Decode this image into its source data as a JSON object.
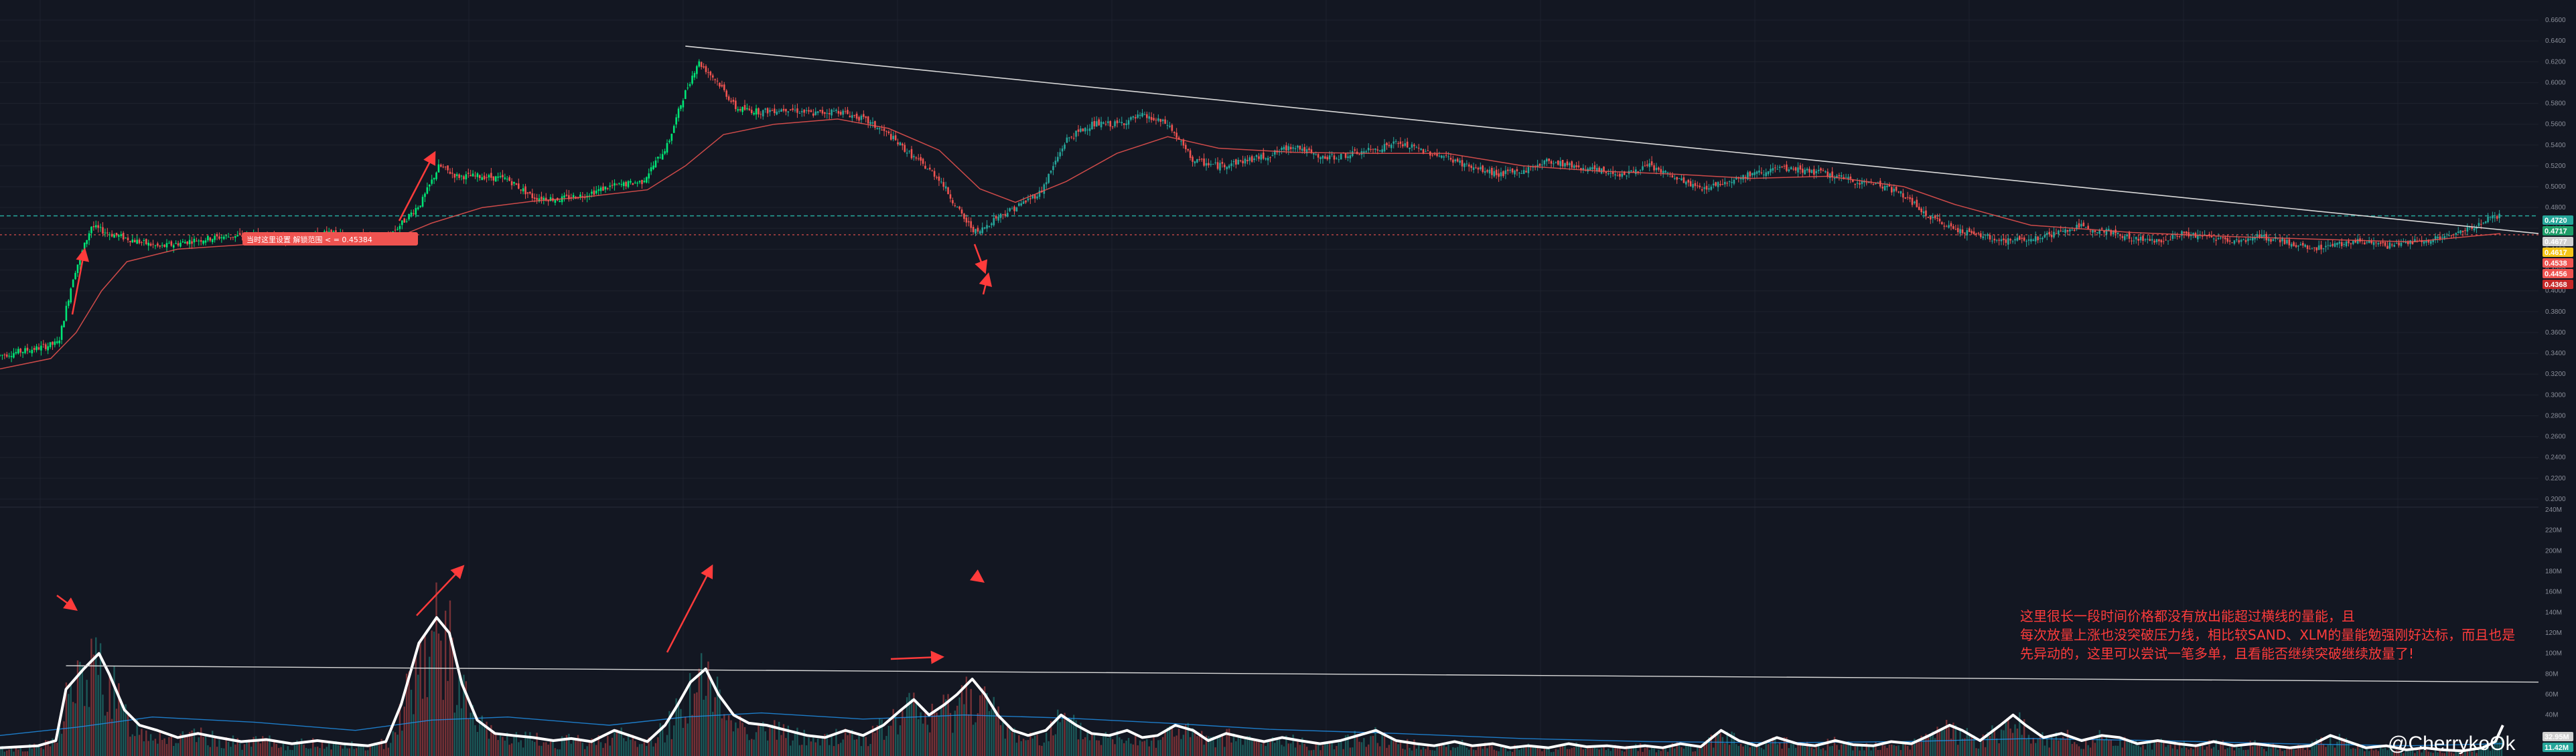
{
  "colors": {
    "background": "#131722",
    "up": "#26a69a",
    "up_bright": "#00e676",
    "down": "#ef5350",
    "ma": "#ef5350",
    "volume_line": "#ffffff",
    "volume_ma": "#2196f3",
    "trendline": "#d9d9d9",
    "annotation": "#ff3b3b",
    "grid": "#1e222d",
    "green_dashed": "#26a69a",
    "red_dotted": "#ef5350"
  },
  "watermark": "@CherrykoOk",
  "annotation": {
    "lines": [
      "这里很长一段时间价格都没有放出能超过横线的量能，且",
      "每次放量上涨也没突破压力线，相比较SAND、XLM的量能勉强刚好达标，而且也是",
      "先异动的，这里可以尝试一笔多单，且看能否继续突破继续放量了!"
    ]
  },
  "flag_label": "当时这里设置 解锁范围 < = 0.45384",
  "price_axis": {
    "ticks": [
      "0.6600",
      "0.6400",
      "0.6200",
      "0.6000",
      "0.5800",
      "0.5600",
      "0.5400",
      "0.5200",
      "0.5000",
      "0.4800",
      "0.4600",
      "0.4400",
      "0.4200",
      "0.4000",
      "0.3800",
      "0.3600",
      "0.3400",
      "0.3200",
      "0.3000",
      "0.2800",
      "0.2600",
      "0.2400",
      "0.2200",
      "0.2000"
    ],
    "badges": [
      {
        "label": "0.4720",
        "color": "#26a69a"
      },
      {
        "label": "0.4717",
        "color": "#1e9e6a"
      },
      {
        "label": "0.4677",
        "color": "#d0d0d0"
      },
      {
        "label": "0.4617",
        "color": "#f5c518"
      },
      {
        "label": "0.4538",
        "color": "#ef5350"
      },
      {
        "label": "0.4456",
        "color": "#ef5350"
      },
      {
        "label": "0.4368",
        "color": "#c62828"
      }
    ]
  },
  "volume_axis": {
    "ticks": [
      "240M",
      "220M",
      "200M",
      "180M",
      "160M",
      "140M",
      "120M",
      "100M",
      "80M",
      "60M",
      "40M",
      "20M"
    ],
    "badges": [
      {
        "label": "32.95M",
        "color": "#d0d0d0"
      },
      {
        "label": "11.42M",
        "color": "#26a69a"
      }
    ]
  },
  "chart_data": [
    {
      "type": "line",
      "name": "price",
      "ylim": [
        0.2,
        0.66
      ],
      "x_range": [
        0,
        100
      ],
      "points": [
        [
          0,
          0.338
        ],
        [
          1.5,
          0.345
        ],
        [
          2.3,
          0.35
        ],
        [
          2.9,
          0.415
        ],
        [
          3.6,
          0.462
        ],
        [
          4.3,
          0.455
        ],
        [
          5.5,
          0.447
        ],
        [
          6.3,
          0.442
        ],
        [
          7.5,
          0.448
        ],
        [
          8.8,
          0.452
        ],
        [
          10.2,
          0.453
        ],
        [
          11.5,
          0.448
        ],
        [
          12.8,
          0.455
        ],
        [
          14.0,
          0.452
        ],
        [
          15.1,
          0.448
        ],
        [
          15.8,
          0.464
        ],
        [
          16.6,
          0.485
        ],
        [
          17.3,
          0.52
        ],
        [
          18.0,
          0.51
        ],
        [
          19.0,
          0.51
        ],
        [
          20.0,
          0.507
        ],
        [
          21.0,
          0.49
        ],
        [
          22.0,
          0.488
        ],
        [
          23.0,
          0.492
        ],
        [
          24.0,
          0.5
        ],
        [
          25.3,
          0.505
        ],
        [
          26.3,
          0.54
        ],
        [
          26.9,
          0.585
        ],
        [
          27.5,
          0.62
        ],
        [
          28.3,
          0.6
        ],
        [
          29.0,
          0.575
        ],
        [
          30.0,
          0.572
        ],
        [
          31.0,
          0.575
        ],
        [
          32.0,
          0.57
        ],
        [
          33.0,
          0.573
        ],
        [
          34.0,
          0.565
        ],
        [
          35.0,
          0.55
        ],
        [
          36.0,
          0.528
        ],
        [
          37.0,
          0.508
        ],
        [
          38.0,
          0.468
        ],
        [
          38.5,
          0.455
        ],
        [
          39.2,
          0.47
        ],
        [
          40.0,
          0.48
        ],
        [
          41.0,
          0.495
        ],
        [
          42.0,
          0.545
        ],
        [
          43.0,
          0.56
        ],
        [
          44.0,
          0.56
        ],
        [
          45.0,
          0.568
        ],
        [
          46.0,
          0.56
        ],
        [
          47.0,
          0.525
        ],
        [
          48.0,
          0.52
        ],
        [
          49.0,
          0.525
        ],
        [
          50.0,
          0.53
        ],
        [
          51.0,
          0.54
        ],
        [
          52.0,
          0.527
        ],
        [
          53.0,
          0.53
        ],
        [
          54.0,
          0.535
        ],
        [
          55.0,
          0.542
        ],
        [
          56.0,
          0.535
        ],
        [
          57.0,
          0.528
        ],
        [
          58.0,
          0.518
        ],
        [
          59.0,
          0.512
        ],
        [
          60.0,
          0.515
        ],
        [
          61.0,
          0.525
        ],
        [
          62.0,
          0.52
        ],
        [
          63.0,
          0.515
        ],
        [
          64.0,
          0.512
        ],
        [
          65.0,
          0.52
        ],
        [
          66.0,
          0.508
        ],
        [
          67.0,
          0.498
        ],
        [
          68.0,
          0.505
        ],
        [
          69.0,
          0.512
        ],
        [
          70.0,
          0.517
        ],
        [
          71.0,
          0.516
        ],
        [
          72.0,
          0.512
        ],
        [
          73.0,
          0.505
        ],
        [
          74.0,
          0.503
        ],
        [
          75.0,
          0.492
        ],
        [
          76.0,
          0.47
        ],
        [
          77.0,
          0.46
        ],
        [
          78.0,
          0.453
        ],
        [
          79.0,
          0.448
        ],
        [
          80.0,
          0.45
        ],
        [
          81.0,
          0.455
        ],
        [
          82.0,
          0.462
        ],
        [
          83.0,
          0.457
        ],
        [
          84.0,
          0.45
        ],
        [
          85.0,
          0.448
        ],
        [
          86.0,
          0.455
        ],
        [
          87.0,
          0.452
        ],
        [
          88.0,
          0.448
        ],
        [
          89.0,
          0.452
        ],
        [
          90.0,
          0.447
        ],
        [
          91.0,
          0.44
        ],
        [
          92.0,
          0.445
        ],
        [
          93.0,
          0.448
        ],
        [
          94.0,
          0.443
        ],
        [
          95.0,
          0.447
        ],
        [
          96.0,
          0.45
        ],
        [
          97.0,
          0.456
        ],
        [
          98.0,
          0.47
        ],
        [
          98.5,
          0.472
        ]
      ]
    },
    {
      "type": "line",
      "name": "price_ma",
      "ylim": [
        0.2,
        0.66
      ],
      "x_range": [
        0,
        100
      ],
      "points": [
        [
          0,
          0.325
        ],
        [
          2.0,
          0.335
        ],
        [
          3.0,
          0.36
        ],
        [
          4.0,
          0.4
        ],
        [
          5.0,
          0.428
        ],
        [
          7.0,
          0.44
        ],
        [
          10.0,
          0.445
        ],
        [
          13.0,
          0.447
        ],
        [
          15.5,
          0.45
        ],
        [
          17.0,
          0.465
        ],
        [
          19.0,
          0.48
        ],
        [
          21.0,
          0.486
        ],
        [
          23.0,
          0.49
        ],
        [
          25.5,
          0.497
        ],
        [
          27.0,
          0.52
        ],
        [
          28.5,
          0.55
        ],
        [
          30.5,
          0.56
        ],
        [
          33.0,
          0.565
        ],
        [
          35.0,
          0.556
        ],
        [
          37.0,
          0.535
        ],
        [
          38.6,
          0.498
        ],
        [
          40.0,
          0.485
        ],
        [
          42.0,
          0.505
        ],
        [
          44.0,
          0.532
        ],
        [
          46.0,
          0.548
        ],
        [
          48.0,
          0.537
        ],
        [
          51.0,
          0.533
        ],
        [
          54.0,
          0.532
        ],
        [
          57.0,
          0.532
        ],
        [
          60.0,
          0.52
        ],
        [
          63.0,
          0.515
        ],
        [
          66.0,
          0.512
        ],
        [
          69.0,
          0.508
        ],
        [
          72.0,
          0.51
        ],
        [
          75.0,
          0.5
        ],
        [
          77.0,
          0.483
        ],
        [
          80.0,
          0.463
        ],
        [
          84.0,
          0.456
        ],
        [
          88.0,
          0.452
        ],
        [
          92.0,
          0.449
        ],
        [
          95.0,
          0.447
        ],
        [
          98.5,
          0.455
        ]
      ]
    },
    {
      "type": "line",
      "name": "trendline",
      "ylim": [
        0.2,
        0.66
      ],
      "points": [
        [
          27.0,
          0.635
        ],
        [
          100,
          0.455
        ]
      ]
    },
    {
      "type": "line",
      "name": "green_dashed_level",
      "ylim": [
        0.2,
        0.66
      ],
      "points": [
        [
          0,
          0.472
        ],
        [
          100,
          0.472
        ]
      ]
    },
    {
      "type": "line",
      "name": "red_dotted_level",
      "ylim": [
        0.2,
        0.66
      ],
      "points": [
        [
          0,
          0.4538
        ],
        [
          100,
          0.4538
        ]
      ]
    },
    {
      "type": "line",
      "name": "volume",
      "ylim": [
        0,
        240
      ],
      "x_range": [
        0,
        100
      ],
      "points": [
        [
          0,
          8
        ],
        [
          1.5,
          10
        ],
        [
          2.2,
          15
        ],
        [
          2.6,
          65
        ],
        [
          3.3,
          85
        ],
        [
          3.9,
          100
        ],
        [
          4.3,
          80
        ],
        [
          4.9,
          45
        ],
        [
          5.5,
          30
        ],
        [
          6.2,
          25
        ],
        [
          7.0,
          18
        ],
        [
          7.8,
          22
        ],
        [
          8.6,
          18
        ],
        [
          9.5,
          14
        ],
        [
          10.5,
          16
        ],
        [
          11.5,
          12
        ],
        [
          12.5,
          15
        ],
        [
          13.5,
          12
        ],
        [
          14.5,
          10
        ],
        [
          15.2,
          14
        ],
        [
          15.8,
          50
        ],
        [
          16.5,
          110
        ],
        [
          17.2,
          135
        ],
        [
          17.7,
          120
        ],
        [
          18.2,
          70
        ],
        [
          18.8,
          35
        ],
        [
          19.5,
          22
        ],
        [
          20.2,
          20
        ],
        [
          21.0,
          18
        ],
        [
          21.8,
          15
        ],
        [
          22.5,
          17
        ],
        [
          23.3,
          14
        ],
        [
          24.2,
          25
        ],
        [
          24.8,
          20
        ],
        [
          25.5,
          14
        ],
        [
          26.2,
          30
        ],
        [
          26.7,
          50
        ],
        [
          27.2,
          72
        ],
        [
          27.8,
          85
        ],
        [
          28.3,
          60
        ],
        [
          28.9,
          40
        ],
        [
          29.5,
          32
        ],
        [
          30.2,
          30
        ],
        [
          31.0,
          25
        ],
        [
          31.8,
          20
        ],
        [
          32.5,
          18
        ],
        [
          33.3,
          25
        ],
        [
          34.0,
          20
        ],
        [
          34.8,
          30
        ],
        [
          35.5,
          45
        ],
        [
          36.0,
          55
        ],
        [
          36.6,
          40
        ],
        [
          37.2,
          50
        ],
        [
          37.7,
          60
        ],
        [
          38.3,
          75
        ],
        [
          38.8,
          60
        ],
        [
          39.3,
          40
        ],
        [
          39.9,
          25
        ],
        [
          40.5,
          20
        ],
        [
          41.2,
          25
        ],
        [
          41.8,
          40
        ],
        [
          42.4,
          30
        ],
        [
          43.0,
          22
        ],
        [
          43.7,
          20
        ],
        [
          44.4,
          25
        ],
        [
          45.0,
          18
        ],
        [
          45.6,
          20
        ],
        [
          46.3,
          30
        ],
        [
          47.0,
          25
        ],
        [
          47.6,
          15
        ],
        [
          48.3,
          22
        ],
        [
          49.0,
          18
        ],
        [
          49.8,
          14
        ],
        [
          50.5,
          18
        ],
        [
          51.2,
          15
        ],
        [
          52.0,
          12
        ],
        [
          52.8,
          15
        ],
        [
          53.5,
          20
        ],
        [
          54.2,
          25
        ],
        [
          55.0,
          15
        ],
        [
          55.8,
          12
        ],
        [
          56.5,
          10
        ],
        [
          57.3,
          14
        ],
        [
          58.0,
          10
        ],
        [
          58.8,
          12
        ],
        [
          59.5,
          8
        ],
        [
          60.2,
          10
        ],
        [
          61.0,
          8
        ],
        [
          61.8,
          12
        ],
        [
          62.5,
          9
        ],
        [
          63.3,
          10
        ],
        [
          64.0,
          8
        ],
        [
          64.8,
          10
        ],
        [
          65.5,
          8
        ],
        [
          66.2,
          12
        ],
        [
          67.0,
          9
        ],
        [
          67.8,
          25
        ],
        [
          68.5,
          15
        ],
        [
          69.2,
          10
        ],
        [
          70.0,
          18
        ],
        [
          70.8,
          12
        ],
        [
          71.5,
          10
        ],
        [
          72.3,
          15
        ],
        [
          73.0,
          11
        ],
        [
          73.8,
          10
        ],
        [
          74.5,
          14
        ],
        [
          75.3,
          12
        ],
        [
          76.0,
          20
        ],
        [
          76.8,
          30
        ],
        [
          77.3,
          25
        ],
        [
          78.0,
          15
        ],
        [
          78.8,
          30
        ],
        [
          79.3,
          40
        ],
        [
          79.8,
          30
        ],
        [
          80.5,
          18
        ],
        [
          81.2,
          22
        ],
        [
          82.0,
          15
        ],
        [
          82.8,
          20
        ],
        [
          83.5,
          18
        ],
        [
          84.2,
          12
        ],
        [
          85.0,
          15
        ],
        [
          85.8,
          12
        ],
        [
          86.5,
          10
        ],
        [
          87.2,
          14
        ],
        [
          88.0,
          10
        ],
        [
          88.8,
          12
        ],
        [
          89.5,
          10
        ],
        [
          90.2,
          8
        ],
        [
          91.0,
          10
        ],
        [
          91.8,
          20
        ],
        [
          92.5,
          14
        ],
        [
          93.2,
          8
        ],
        [
          94.0,
          10
        ],
        [
          94.8,
          6
        ],
        [
          95.5,
          8
        ],
        [
          96.2,
          6
        ],
        [
          97.0,
          5
        ],
        [
          97.8,
          8
        ],
        [
          98.3,
          14
        ],
        [
          98.6,
          30
        ]
      ]
    },
    {
      "type": "line",
      "name": "volume_ma",
      "ylim": [
        0,
        240
      ],
      "x_range": [
        0,
        100
      ],
      "points": [
        [
          0,
          20
        ],
        [
          3,
          28
        ],
        [
          6,
          38
        ],
        [
          10,
          33
        ],
        [
          14,
          25
        ],
        [
          17,
          35
        ],
        [
          20,
          38
        ],
        [
          24,
          30
        ],
        [
          27,
          38
        ],
        [
          30,
          42
        ],
        [
          34,
          36
        ],
        [
          38,
          40
        ],
        [
          42,
          37
        ],
        [
          46,
          32
        ],
        [
          50,
          26
        ],
        [
          55,
          22
        ],
        [
          60,
          17
        ],
        [
          65,
          14
        ],
        [
          70,
          13
        ],
        [
          75,
          14
        ],
        [
          80,
          17
        ],
        [
          85,
          15
        ],
        [
          90,
          12
        ],
        [
          95,
          10
        ],
        [
          98.6,
          12
        ]
      ]
    },
    {
      "type": "line",
      "name": "volume_trendline",
      "ylim": [
        0,
        240
      ],
      "points": [
        [
          2.6,
          88
        ],
        [
          100,
          72
        ]
      ]
    }
  ]
}
